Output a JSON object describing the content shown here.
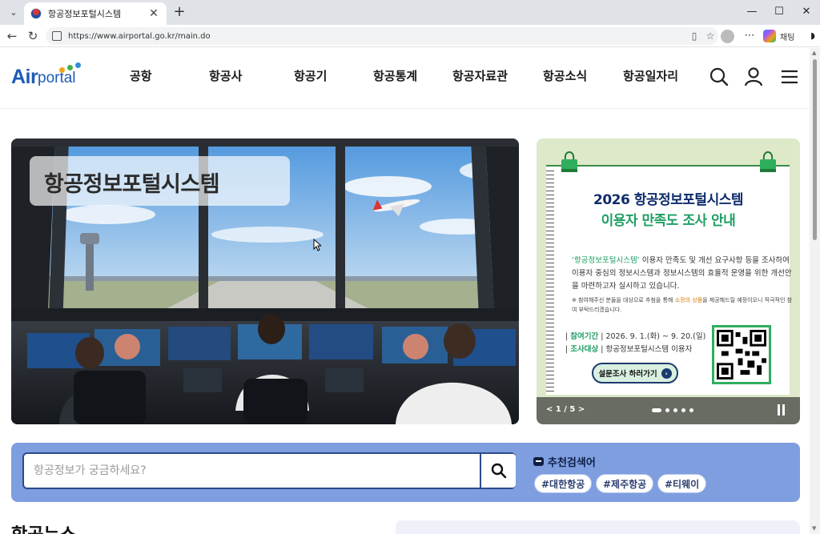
{
  "browser": {
    "tab_title": "항공정보포털시스템",
    "url": "https://www.airportal.go.kr/main.do",
    "copilot_label": "채팅",
    "new_tab": "+",
    "close_tab": "✕",
    "minimize": "—",
    "maximize": "☐",
    "close": "✕"
  },
  "header": {
    "logo_part1": "Air",
    "logo_part2": "portal",
    "nav": [
      "공항",
      "항공사",
      "항공기",
      "항공통계",
      "항공자료관",
      "항공소식",
      "항공일자리"
    ],
    "icons": [
      "search-icon",
      "user-icon",
      "hamburger-menu-icon"
    ]
  },
  "hero": {
    "title": "항공정보포털시스템"
  },
  "banner": {
    "title_line1": "2026 항공정보포털시스템",
    "title_line2": "이용자 만족도 조사 안내",
    "desc_highlight": "‘항공정보포털시스템’",
    "desc_rest": " 이용자 만족도 및 개선 요구사항 등을 조사하여 이용자 중심의 정보시스템과 정보시스템의 효율적 운영을 위한 개선안을 마련하고자 실시하고 있습니다.",
    "note_pre": "※ 참여해주신 분들을 대상으로 추첨을 통해 ",
    "note_highlight": "소정의 상품",
    "note_post": "을 제공해드릴 예정이오니 적극적인 참여 부탁드리겠습니다.",
    "period_label": "참여기간",
    "period_value": "2026. 9. 1.(화) ~ 9. 20.(일)",
    "target_label": "조사대상",
    "target_value": "항공정보포털시스템 이용자",
    "button_label": "설문조사 하러가기",
    "pager": "< 1 / 5 >",
    "slide_count": 5,
    "active_slide": 1,
    "bg_color": "#dde9c8",
    "accent_green": "#1f9e63",
    "accent_navy": "#0e2b6b"
  },
  "search": {
    "placeholder": "항공정보가 궁금하세요?",
    "rec_title": "추천검색어",
    "chips": [
      "#대한항공",
      "#제주항공",
      "#티웨이"
    ],
    "bg_color": "#7e9ee0"
  },
  "next_section": {
    "heading": "항공뉴스"
  }
}
